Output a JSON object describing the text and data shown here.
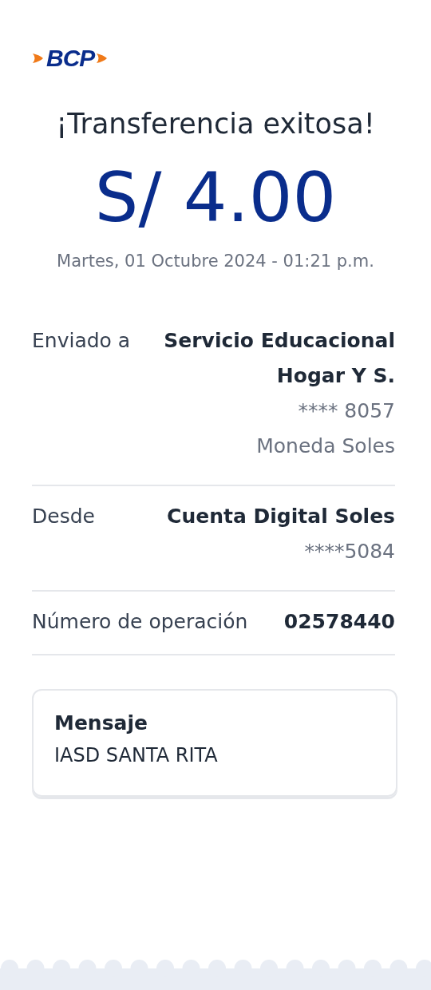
{
  "logo": {
    "text": "BCP"
  },
  "title": "¡Transferencia exitosa!",
  "amount": "S/ 4.00",
  "datetime": "Martes, 01 Octubre 2024 - 01:21 p.m.",
  "details": [
    {
      "label": "Enviado a",
      "lines": [
        {
          "kind": "strong",
          "text": "Servicio Educacional Hogar Y S."
        },
        {
          "kind": "plain",
          "text": "**** 8057"
        },
        {
          "kind": "plain",
          "text": "Moneda Soles"
        }
      ]
    },
    {
      "label": "Desde",
      "lines": [
        {
          "kind": "strong",
          "text": "Cuenta Digital Soles"
        },
        {
          "kind": "plain",
          "text": "****5084"
        }
      ]
    },
    {
      "label": "Número de operación",
      "lines": [
        {
          "kind": "strong",
          "text": "02578440"
        }
      ]
    }
  ],
  "message": {
    "heading": "Mensaje",
    "text": "IASD SANTA RITA"
  }
}
